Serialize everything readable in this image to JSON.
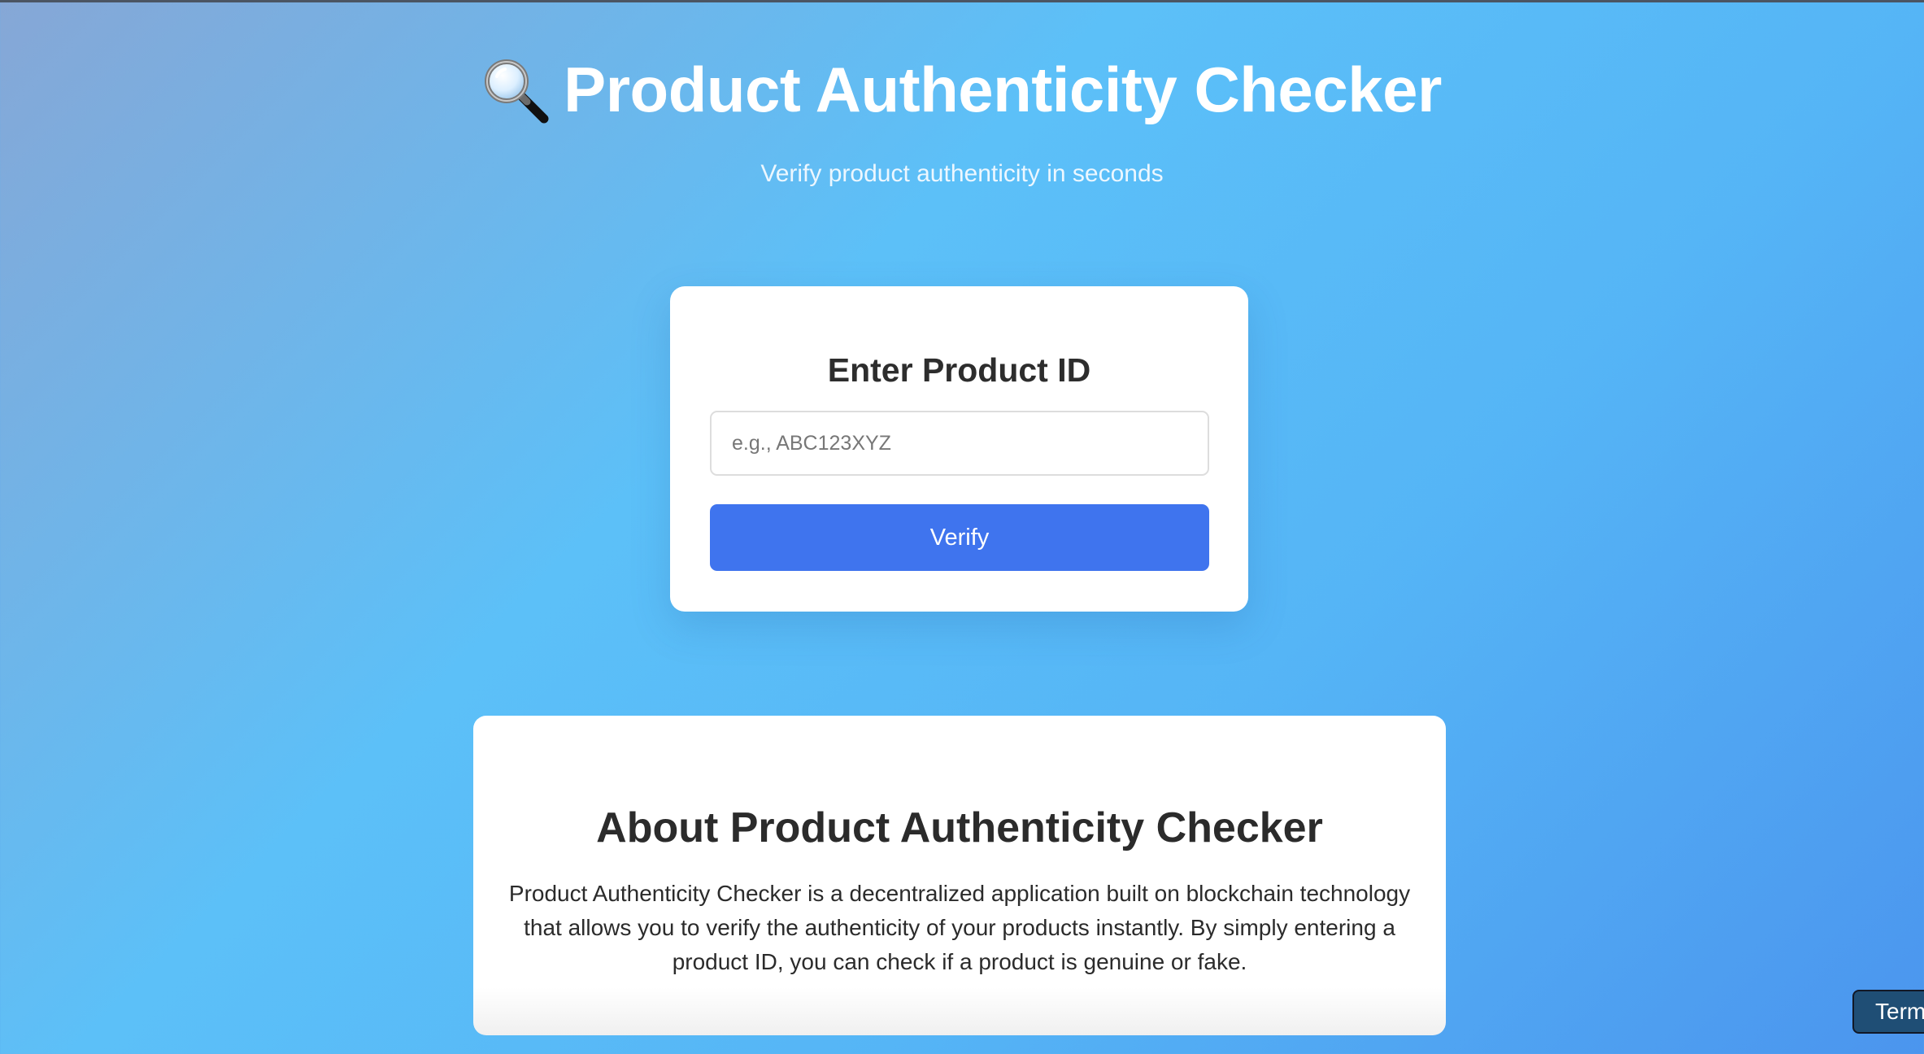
{
  "header": {
    "title": "Product Authenticity Checker",
    "title_icon": "magnifying-glass-icon",
    "subtitle": "Verify product authenticity in seconds"
  },
  "verify_card": {
    "heading": "Enter Product ID",
    "input_placeholder": "e.g., ABC123XYZ",
    "input_value": "",
    "button_label": "Verify"
  },
  "about": {
    "heading": "About Product Authenticity Checker",
    "description": "Product Authenticity Checker is a decentralized application built on blockchain technology that allows you to verify the authenticity of your products instantly. By simply entering a product ID, you can check if a product is genuine or fake."
  },
  "floating_tab": {
    "label": "Term"
  },
  "colors": {
    "button": "#3f74ee",
    "background_start": "#86a7d6",
    "background_mid": "#5cc0f8",
    "background_end": "#4b95ee",
    "tab": "#1f4e75"
  }
}
